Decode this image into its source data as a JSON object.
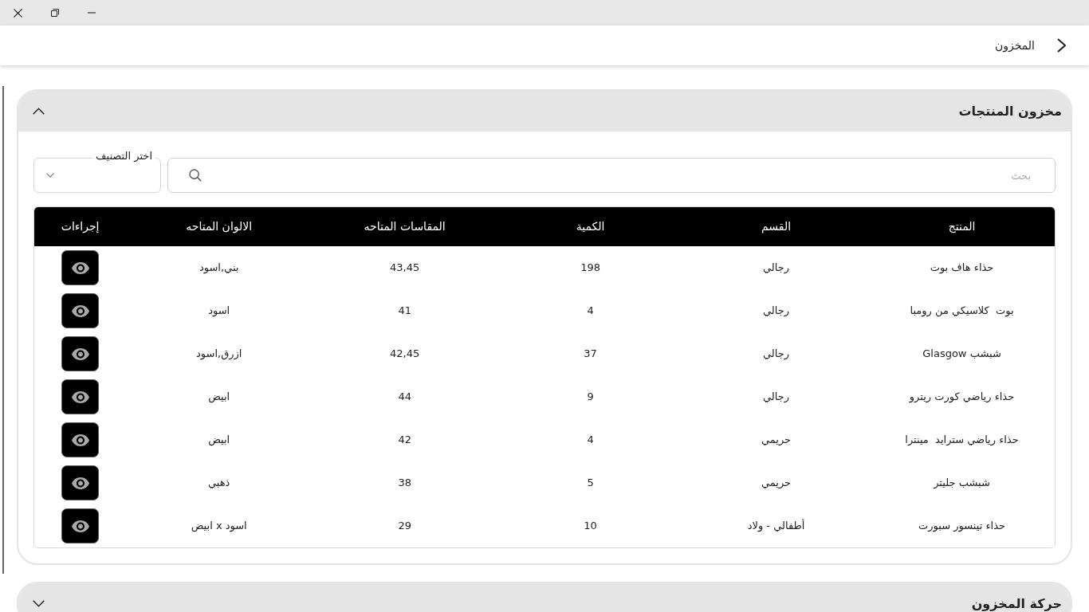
{
  "app_bar": {
    "title": "المخزون"
  },
  "sections": [
    {
      "title": "مخزون المنتجات",
      "expanded": true,
      "search": {
        "placeholder": "بحث"
      },
      "category_filter": {
        "label": "اختر التصنيف"
      },
      "table": {
        "columns": [
          "المنتج",
          "القسم",
          "الكمية",
          "المقاسات المتاحه",
          "الالوان المتاحه",
          "إجراءات"
        ],
        "rows": [
          [
            "حذاء هاف بوت",
            "رجالي",
            "198",
            "43,45",
            "بني,اسود"
          ],
          [
            "بوت  كلاسيكي من رومبا",
            "رجالي",
            "4",
            "41",
            "اسود"
          ],
          [
            "شبشب Glasgow",
            "رجالي",
            "37",
            "42,45",
            "ازرق,اسود"
          ],
          [
            "حذاء رياضي كورت ريترو",
            "رجالي",
            "9",
            "44",
            "ابيض"
          ],
          [
            "حذاء رياضي سترايد  مينترا",
            "حريمي",
            "4",
            "42",
            "ابيض"
          ],
          [
            "شبشب جليتر",
            "حريمي",
            "5",
            "38",
            "ذهبي"
          ],
          [
            "حذاء تينسور سبورت",
            "أطفالي - ولاد",
            "10",
            "29",
            "اسود x ابيض"
          ]
        ]
      }
    },
    {
      "title": "حركة المخزون",
      "expanded": false
    }
  ]
}
